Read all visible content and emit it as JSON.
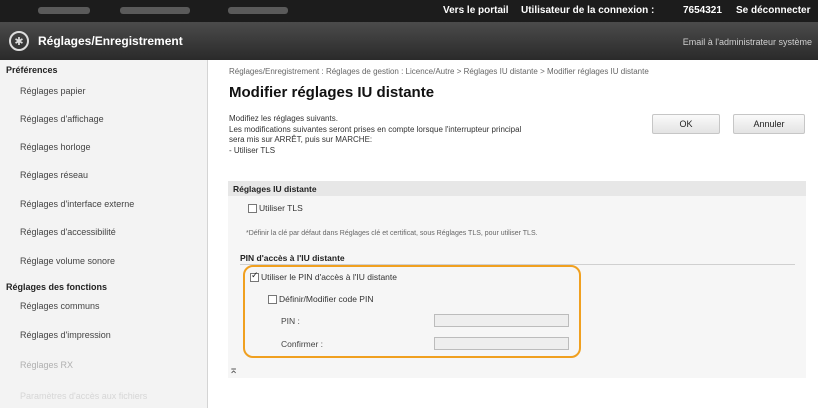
{
  "topbar": {
    "portal_link": "Vers le portail",
    "user_label": "Utilisateur de la connexion :",
    "user_id": "7654321",
    "logout_link": "Se déconnecter"
  },
  "header": {
    "title": "Réglages/Enregistrement",
    "admin_email": "Email à l'administrateur système"
  },
  "sidebar": {
    "preferences_title": "Préférences",
    "preferences_items": [
      "Réglages papier",
      "Réglages d'affichage",
      "Réglages horloge",
      "Réglages réseau",
      "Réglages d'interface externe",
      "Réglages d'accessibilité",
      "Réglage volume sonore"
    ],
    "functions_title": "Réglages des fonctions",
    "functions_items": [
      "Réglages communs",
      "Réglages d'impression",
      "Réglages RX",
      "Paramètres d'accès aux fichiers"
    ]
  },
  "main": {
    "breadcrumb": "Réglages/Enregistrement : Réglages de gestion : Licence/Autre > Réglages IU distante > Modifier réglages IU distante",
    "title": "Modifier réglages IU distante",
    "intro": "Modifiez les réglages suivants.\nLes modifications suivantes seront prises en compte lorsque l'interrupteur principal\nsera mis sur ARRÊT, puis sur MARCHE:\n- Utiliser TLS",
    "ok_label": "OK",
    "cancel_label": "Annuler",
    "section_title": "Réglages IU distante",
    "use_tls_label": "Utiliser TLS",
    "use_tls_checked": false,
    "tls_note": "*Définir la clé par défaut dans Réglages clé et certificat, sous Réglages TLS, pour utiliser TLS.",
    "pin_section_title": "PIN d'accès à l'IU distante",
    "use_pin_label": "Utiliser le PIN d'accès à l'IU distante",
    "use_pin_checked": true,
    "set_pin_label": "Définir/Modifier code PIN",
    "set_pin_checked": false,
    "pin_label": "PIN :",
    "pin_value": "",
    "confirm_label": "Confirmer :",
    "confirm_value": "",
    "anchor_icon": "anchor-icon",
    "highlight_color": "#f0a020"
  }
}
